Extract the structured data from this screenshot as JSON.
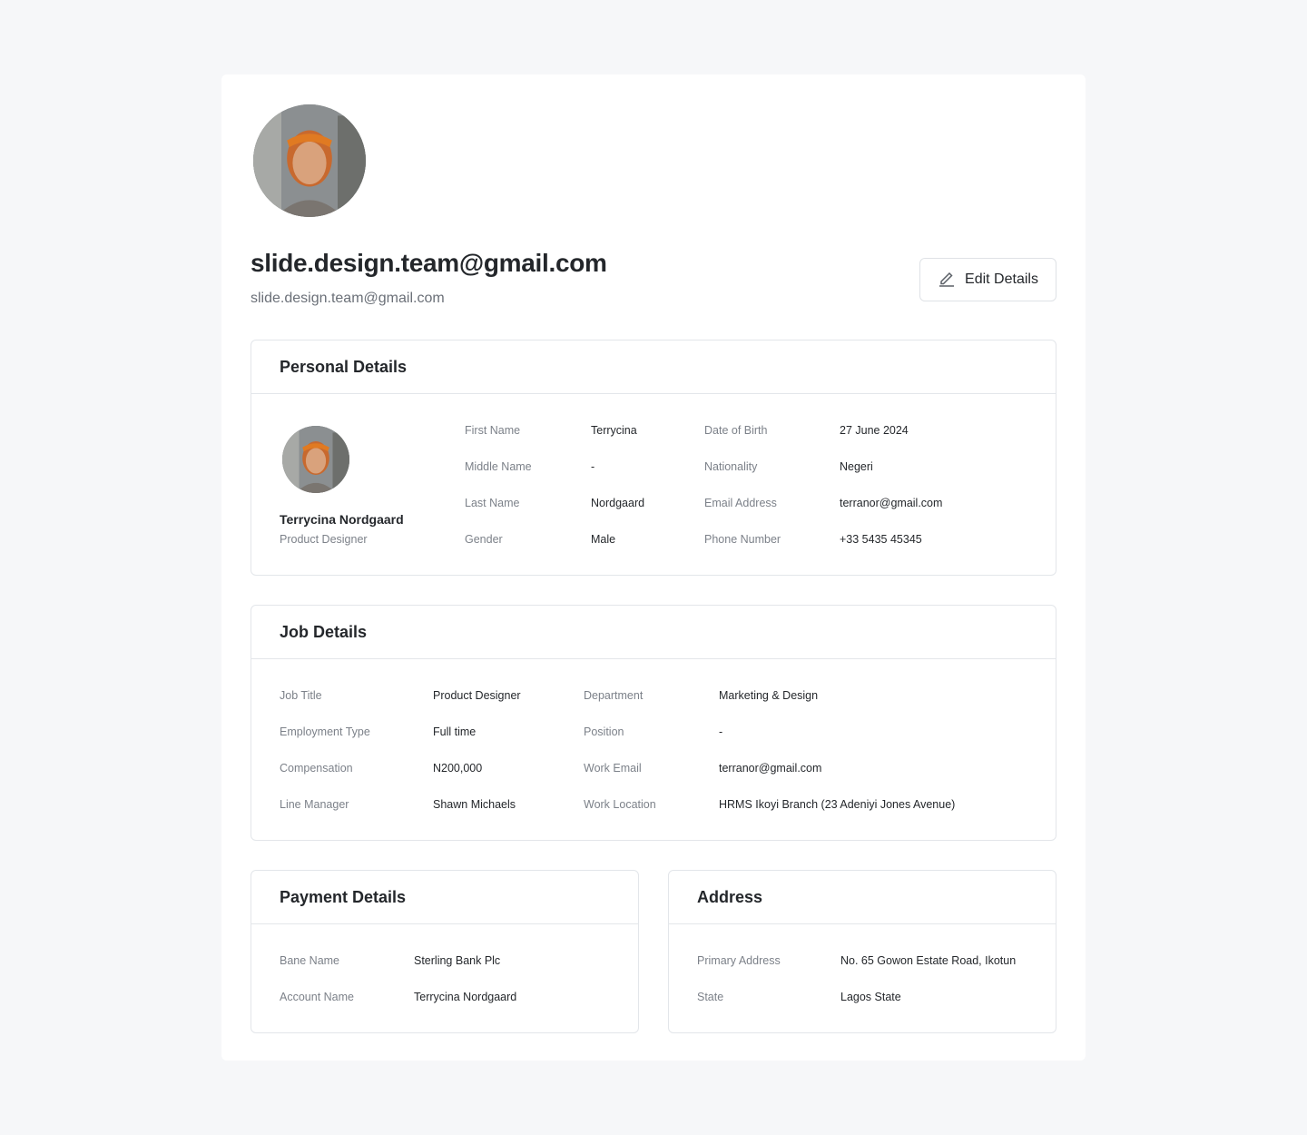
{
  "profile": {
    "title": "slide.design.team@gmail.com",
    "subtitle": "slide.design.team@gmail.com",
    "edit_label": "Edit Details"
  },
  "personal": {
    "heading": "Personal Details",
    "name": "Terrycina Nordgaard",
    "role": "Product Designer",
    "left": [
      {
        "label": "First Name",
        "value": "Terrycina"
      },
      {
        "label": "Middle Name",
        "value": "-"
      },
      {
        "label": "Last Name",
        "value": "Nordgaard"
      },
      {
        "label": "Gender",
        "value": "Male"
      }
    ],
    "right": [
      {
        "label": "Date of Birth",
        "value": "27 June 2024"
      },
      {
        "label": "Nationality",
        "value": "Negeri"
      },
      {
        "label": "Email Address",
        "value": "terranor@gmail.com"
      },
      {
        "label": "Phone Number",
        "value": "+33 5435 45345"
      }
    ]
  },
  "job": {
    "heading": "Job Details",
    "left": [
      {
        "label": "Job Title",
        "value": "Product Designer"
      },
      {
        "label": "Employment Type",
        "value": "Full time"
      },
      {
        "label": "Compensation",
        "value": "N200,000"
      },
      {
        "label": "Line Manager",
        "value": "Shawn Michaels"
      }
    ],
    "right": [
      {
        "label": "Department",
        "value": "Marketing & Design"
      },
      {
        "label": "Position",
        "value": "-"
      },
      {
        "label": "Work Email",
        "value": "terranor@gmail.com"
      },
      {
        "label": "Work Location",
        "value": "HRMS Ikoyi Branch (23 Adeniyi Jones Avenue)"
      }
    ]
  },
  "payment": {
    "heading": "Payment Details",
    "rows": [
      {
        "label": "Bane Name",
        "value": "Sterling Bank Plc"
      },
      {
        "label": "Account Name",
        "value": "Terrycina Nordgaard"
      }
    ]
  },
  "address": {
    "heading": "Address",
    "rows": [
      {
        "label": "Primary Address",
        "value": "No. 65 Gowon Estate Road, Ikotun"
      },
      {
        "label": "State",
        "value": "Lagos State"
      }
    ]
  }
}
